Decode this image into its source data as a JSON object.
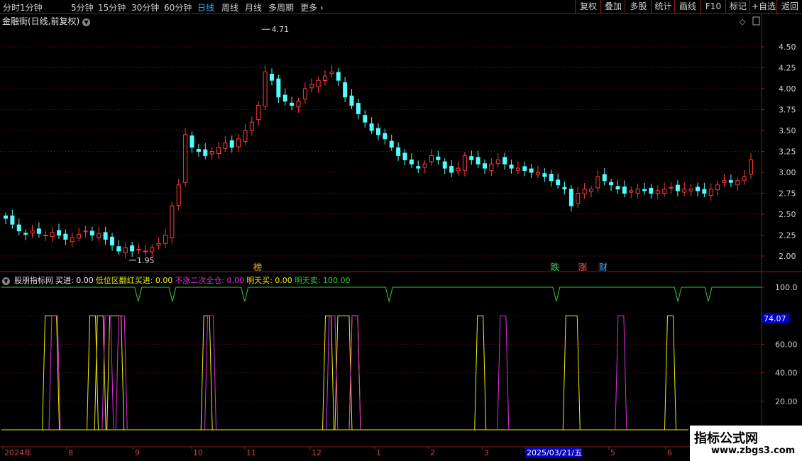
{
  "toolbar": {
    "periods": [
      "分时",
      "1分钟",
      "5分钟",
      "15分钟",
      "30分钟",
      "60分钟",
      "日线",
      "周线",
      "月线",
      "多周期",
      "更多"
    ],
    "active": "日线",
    "right_buttons": [
      "复权",
      "叠加",
      "多股",
      "统计",
      "画线",
      "F10",
      "标记",
      "+自选",
      "返回"
    ]
  },
  "stock": {
    "title": "金融街(日线,前复权)"
  },
  "main_chart": {
    "y_ticks": [
      "4.50",
      "4.25",
      "4.00",
      "3.75",
      "3.50",
      "3.25",
      "3.00",
      "2.75",
      "2.50",
      "2.25",
      "2.00"
    ],
    "high_label": "4.71",
    "low_label": "1.95",
    "markers": [
      {
        "text": "榜",
        "color": "#e8a020"
      },
      {
        "text": "跌",
        "color": "#26d14a"
      },
      {
        "text": "涨",
        "color": "#ff4040"
      },
      {
        "text": "财",
        "color": "#3fa2ff"
      }
    ]
  },
  "indicator": {
    "name": "股朋指标网",
    "items": [
      {
        "label": "买进:",
        "value": "0.00",
        "color": "#ffffff"
      },
      {
        "label": "低位区翻红买进:",
        "value": "0.00",
        "color": "#f0f000"
      },
      {
        "label": "不涨二次全仓:",
        "value": "0.00",
        "color": "#e030e0"
      },
      {
        "label": "明天买:",
        "value": "0.00",
        "color": "#f0f000"
      },
      {
        "label": "明天卖:",
        "value": "100.00",
        "color": "#30d030"
      }
    ],
    "y_ticks": [
      "100.0",
      "60.00",
      "40.00",
      "20.00"
    ],
    "current_value": "74.07"
  },
  "x_axis": {
    "labels": [
      "2024年",
      "8",
      "9",
      "10",
      "11",
      "12",
      "1",
      "2",
      "3",
      "2025/03/21/五",
      "5",
      "6"
    ]
  },
  "watermark": {
    "line1": "指标公式网",
    "line2": "www.zbgs3.com"
  },
  "colors": {
    "up": "#ff3b3b",
    "down": "#54fcfc",
    "grid": "#7a1010",
    "axis": "#8b1b1b",
    "active": "#43a9ff"
  },
  "chart_data": {
    "type": "candlestick",
    "x_range": [
      "2024年",
      "6"
    ],
    "ylim": [
      1.9,
      4.8
    ],
    "high": 4.71,
    "low": 1.95,
    "close_approx": [
      2.45,
      2.38,
      2.3,
      2.26,
      2.3,
      2.27,
      2.25,
      2.28,
      2.25,
      2.2,
      2.22,
      2.26,
      2.3,
      2.25,
      2.27,
      2.2,
      2.13,
      2.06,
      2.1,
      2.06,
      2.08,
      2.06,
      2.1,
      2.15,
      2.25,
      2.6,
      2.85,
      3.45,
      3.3,
      3.25,
      3.2,
      3.25,
      3.3,
      3.35,
      3.3,
      3.4,
      3.5,
      3.6,
      3.8,
      4.2,
      4.1,
      3.9,
      3.85,
      3.8,
      3.85,
      4.0,
      4.05,
      4.1,
      4.15,
      4.2,
      4.1,
      3.9,
      3.8,
      3.7,
      3.6,
      3.5,
      3.45,
      3.4,
      3.3,
      3.2,
      3.15,
      3.1,
      3.05,
      3.1,
      3.2,
      3.15,
      3.05,
      3.0,
      3.05,
      3.2,
      3.15,
      3.1,
      3.05,
      3.1,
      3.15,
      3.1,
      3.05,
      3.05,
      3.02,
      3.0,
      3.0,
      2.95,
      2.9,
      2.85,
      2.8,
      2.6,
      2.75,
      2.8,
      2.8,
      2.95,
      2.9,
      2.85,
      2.8,
      2.75,
      2.78,
      2.8,
      2.78,
      2.75,
      2.78,
      2.8,
      2.82,
      2.78,
      2.8,
      2.8,
      2.78,
      2.75,
      2.8,
      2.85,
      2.9,
      2.88,
      2.9,
      2.95,
      3.15
    ],
    "indicator_ylim": [
      0,
      100
    ],
    "indicator_series": [
      {
        "name": "明天卖",
        "color": "#30d030",
        "base": 100,
        "dips": [
          0.18,
          0.225,
          0.32,
          0.51,
          0.73,
          0.89,
          0.93
        ]
      },
      {
        "name": "低位区翻红买进",
        "color": "#f0f000",
        "pulses": [
          0.065,
          0.12,
          0.13,
          0.15,
          0.27,
          0.43,
          0.45,
          0.465,
          0.63,
          0.75,
          0.88
        ]
      },
      {
        "name": "不涨二次全仓",
        "color": "#e030e0",
        "pulses": [
          0.07,
          0.14,
          0.158,
          0.275,
          0.435,
          0.465,
          0.66,
          0.815
        ]
      }
    ]
  }
}
